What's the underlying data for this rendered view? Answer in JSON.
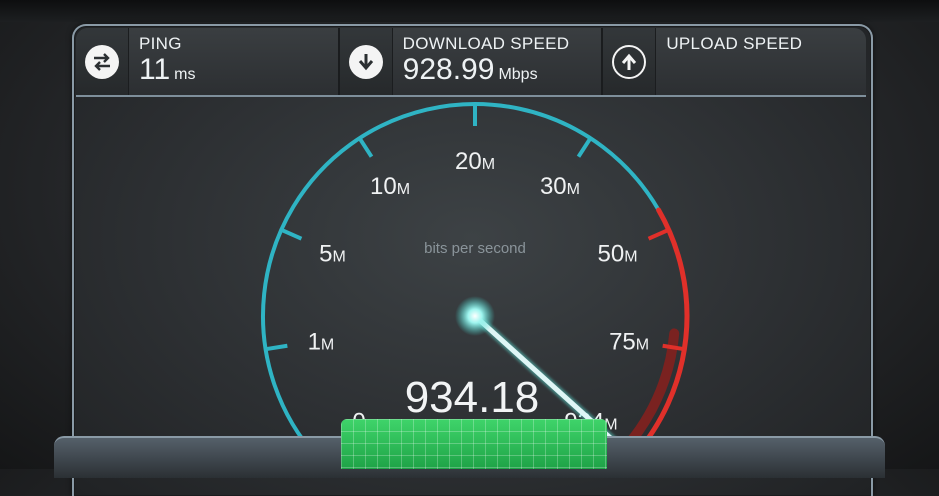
{
  "ping": {
    "label": "PING",
    "value": "11",
    "unit": "ms",
    "icon": "exchange-arrows-icon"
  },
  "download": {
    "label": "DOWNLOAD SPEED",
    "value": "928.99",
    "unit": "Mbps",
    "icon": "download-arrow-icon"
  },
  "upload": {
    "label": "UPLOAD SPEED",
    "icon": "upload-arrow-icon"
  },
  "gauge": {
    "caption": "bits per second",
    "reading": "934.18",
    "ticks": [
      {
        "label": "0",
        "suffix": ""
      },
      {
        "label": "1",
        "suffix": "M"
      },
      {
        "label": "5",
        "suffix": "M"
      },
      {
        "label": "10",
        "suffix": "M"
      },
      {
        "label": "20",
        "suffix": "M"
      },
      {
        "label": "30",
        "suffix": "M"
      },
      {
        "label": "50",
        "suffix": "M"
      },
      {
        "label": "75",
        "suffix": "M"
      },
      {
        "label": "934",
        "suffix": "M"
      }
    ],
    "needle_fraction": 1.0,
    "colors": {
      "normal": "#2fb4c4",
      "high": "#e0302a",
      "needle": "#dff6f6"
    }
  }
}
